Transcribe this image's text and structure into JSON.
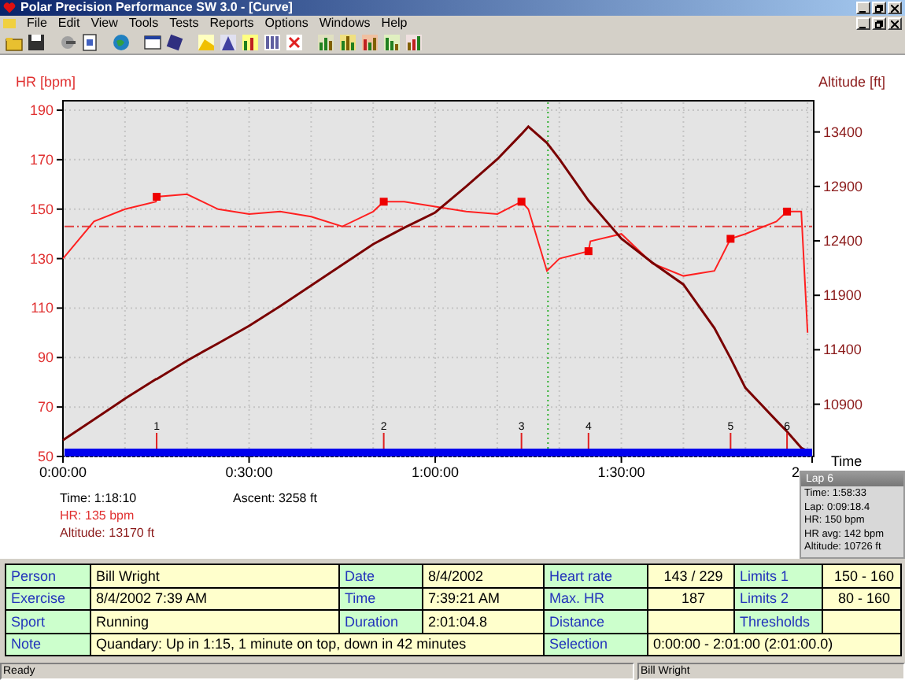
{
  "window": {
    "title": "Polar Precision Performance SW 3.0 - [Curve]"
  },
  "menu": [
    "File",
    "Edit",
    "View",
    "Tools",
    "Tests",
    "Reports",
    "Options",
    "Windows",
    "Help"
  ],
  "chart": {
    "chart_data": {
      "type": "line",
      "xlabel": "Time",
      "x": [
        0,
        5,
        10,
        15,
        15.1,
        20,
        25,
        30,
        35,
        40,
        45,
        50,
        51.7,
        55,
        60,
        65,
        70,
        73.9,
        75,
        78,
        80,
        84.7,
        85,
        90,
        95,
        100,
        105,
        107.6,
        110,
        115,
        116.7,
        119,
        120
      ],
      "grid": true,
      "xlim": [
        0,
        121
      ],
      "ylim": [
        50,
        190
      ],
      "y2lim": [
        10420,
        13600
      ],
      "xticks": [
        {
          "value": 0,
          "label": "0:00:00"
        },
        {
          "value": 30,
          "label": "0:30:00"
        },
        {
          "value": 60,
          "label": "1:00:00"
        },
        {
          "value": 90,
          "label": "1:30:00"
        }
      ],
      "yticks": [
        50,
        70,
        90,
        110,
        130,
        150,
        170,
        190
      ],
      "y2ticks": [
        10900,
        11400,
        11900,
        12400,
        12900,
        13400
      ],
      "series": [
        {
          "name": "HR [bpm]",
          "color": "#ff2020",
          "values": [
            130,
            145,
            150,
            153,
            155,
            156,
            150,
            148,
            149,
            147,
            143,
            149,
            153,
            153,
            151,
            149,
            148,
            153,
            150,
            125,
            130,
            133,
            137,
            140,
            128,
            123,
            125,
            138,
            140,
            145,
            149,
            149,
            100
          ]
        },
        {
          "name": "Altitude [ft]",
          "color": "#7a0000",
          "axis": "y2",
          "values": [
            10570,
            10760,
            10950,
            11130,
            11130,
            11300,
            11460,
            11620,
            11800,
            11990,
            12180,
            12370,
            12420,
            12520,
            12660,
            12900,
            13150,
            13380,
            13450,
            13300,
            13150,
            12770,
            12750,
            12420,
            12200,
            12000,
            11600,
            11320,
            11050,
            10750,
            10650,
            10500,
            10470
          ]
        }
      ],
      "ref_lines": [
        {
          "axis": "y",
          "value": 143
        },
        {
          "axis": "x",
          "value": 78.17
        }
      ],
      "annotations": [
        {
          "x": 15.1,
          "text": "1"
        },
        {
          "x": 51.7,
          "text": "2"
        },
        {
          "x": 73.9,
          "text": "3"
        },
        {
          "x": 84.7,
          "text": "4"
        },
        {
          "x": 107.6,
          "text": "5"
        },
        {
          "x": 116.7,
          "text": "6"
        }
      ]
    },
    "cut_tick_label": "2",
    "cursor_info": [
      {
        "text": "Time: 1:18:10",
        "kind": "time"
      },
      {
        "text": "HR: 135 bpm",
        "kind": "hr"
      },
      {
        "text": "Altitude: 13170 ft",
        "kind": "altitude"
      }
    ],
    "ascent": "Ascent: 3258 ft",
    "lap_popup": {
      "title": "Lap 6",
      "lines": [
        "Time: 1:58:33",
        "Lap: 0:09:18.4",
        "HR: 150 bpm",
        "HR avg: 142 bpm",
        "Altitude: 10726 ft"
      ]
    }
  },
  "table": {
    "rows": [
      [
        {
          "kind": "label",
          "text": "Person"
        },
        {
          "kind": "value",
          "text": "Bill Wright"
        },
        {
          "kind": "label",
          "text": "Date"
        },
        {
          "kind": "value",
          "text": "8/4/2002"
        },
        {
          "kind": "label",
          "text": "Heart rate"
        },
        {
          "kind": "number",
          "text": "143 / 229"
        },
        {
          "kind": "label",
          "text": "Limits 1"
        },
        {
          "kind": "number",
          "text": "150 - 160"
        }
      ],
      [
        {
          "kind": "label",
          "text": "Exercise"
        },
        {
          "kind": "value",
          "text": "8/4/2002 7:39 AM"
        },
        {
          "kind": "label",
          "text": "Time"
        },
        {
          "kind": "value",
          "text": "7:39:21 AM"
        },
        {
          "kind": "label",
          "text": "Max. HR"
        },
        {
          "kind": "number",
          "text": "187"
        },
        {
          "kind": "label",
          "text": "Limits 2"
        },
        {
          "kind": "number",
          "text": "80 - 160"
        }
      ],
      [
        {
          "kind": "label",
          "text": "Sport"
        },
        {
          "kind": "value",
          "text": "Running"
        },
        {
          "kind": "label",
          "text": "Duration"
        },
        {
          "kind": "value",
          "text": "2:01:04.8"
        },
        {
          "kind": "label",
          "text": "Distance"
        },
        {
          "kind": "value"
        },
        {
          "kind": "label",
          "text": "Thresholds"
        },
        {
          "kind": "value"
        }
      ],
      [
        {
          "kind": "label",
          "text": "Note"
        },
        {
          "kind": "value",
          "text": "Quandary: Up in 1:15, 1 minute on top, down in 42 minutes",
          "colspan": 3
        },
        {
          "kind": "label",
          "text": "Selection"
        },
        {
          "kind": "value",
          "text": "0:00:00 - 2:01:00 (2:01:00.0)",
          "colspan": 3
        }
      ]
    ]
  },
  "status_bar": [
    "Ready",
    "Bill Wright"
  ]
}
